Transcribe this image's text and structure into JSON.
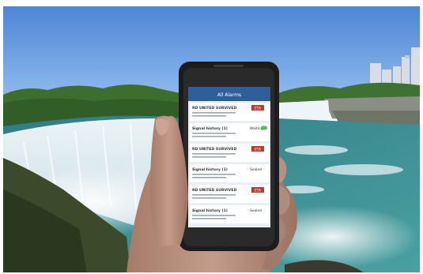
{
  "photo": {
    "subject": "hand-holding-phone-at-waterfall",
    "colors": {
      "sky": "#6fa2e3",
      "sky_top": "#4c86d6",
      "water": "#3d8f93",
      "foam": "#e6f0f2",
      "trees": "#3a6b2c",
      "skin": "#b48a7a",
      "phone_body": "#1c1c1c",
      "screen_bg": "#e9eef2",
      "screen_header": "#2f5f9a",
      "badge_red": "#c0392b",
      "toggle_green": "#5cb85c"
    }
  },
  "phone_screen": {
    "header": "All Alarms",
    "cards": [
      {
        "title": "RD UNITED SURVIVED",
        "badge": "ETA"
      },
      {
        "title": "Signal history (1)",
        "status": "Waiting"
      },
      {
        "title": "RD UNITED SURVIVED",
        "badge": "ETA"
      },
      {
        "title": "Signal history (1)",
        "status": "Sealed"
      },
      {
        "title": "RD UNITED SURVIVED",
        "badge": "ETA"
      },
      {
        "title": "Signal history (1)",
        "status": "Sealed"
      }
    ]
  }
}
